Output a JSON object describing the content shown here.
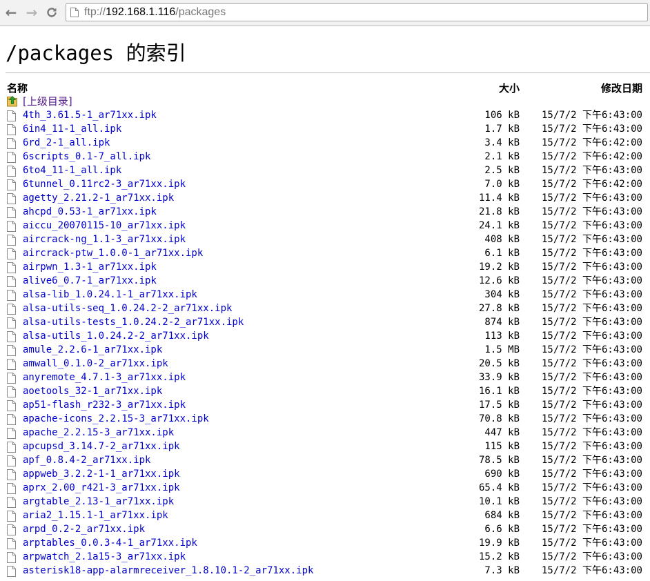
{
  "browser": {
    "url_scheme": "ftp://",
    "url_host": "192.168.1.116",
    "url_path": "/packages"
  },
  "page": {
    "title": "/packages 的索引",
    "columns": {
      "name": "名称",
      "size": "大小",
      "date": "修改日期"
    },
    "parent_link": "[上级目录]",
    "rows": [
      {
        "name": "4th_3.61.5-1_ar71xx.ipk",
        "size": "106 kB",
        "date": "15/7/2 下午6:43:00"
      },
      {
        "name": "6in4_11-1_all.ipk",
        "size": "1.7 kB",
        "date": "15/7/2 下午6:43:00"
      },
      {
        "name": "6rd_2-1_all.ipk",
        "size": "3.4 kB",
        "date": "15/7/2 下午6:42:00"
      },
      {
        "name": "6scripts_0.1-7_all.ipk",
        "size": "2.1 kB",
        "date": "15/7/2 下午6:42:00"
      },
      {
        "name": "6to4_11-1_all.ipk",
        "size": "2.5 kB",
        "date": "15/7/2 下午6:43:00"
      },
      {
        "name": "6tunnel_0.11rc2-3_ar71xx.ipk",
        "size": "7.0 kB",
        "date": "15/7/2 下午6:42:00"
      },
      {
        "name": "agetty_2.21.2-1_ar71xx.ipk",
        "size": "11.4 kB",
        "date": "15/7/2 下午6:43:00"
      },
      {
        "name": "ahcpd_0.53-1_ar71xx.ipk",
        "size": "21.8 kB",
        "date": "15/7/2 下午6:43:00"
      },
      {
        "name": "aiccu_20070115-10_ar71xx.ipk",
        "size": "24.1 kB",
        "date": "15/7/2 下午6:43:00"
      },
      {
        "name": "aircrack-ng_1.1-3_ar71xx.ipk",
        "size": "408 kB",
        "date": "15/7/2 下午6:43:00"
      },
      {
        "name": "aircrack-ptw_1.0.0-1_ar71xx.ipk",
        "size": "6.1 kB",
        "date": "15/7/2 下午6:43:00"
      },
      {
        "name": "airpwn_1.3-1_ar71xx.ipk",
        "size": "19.2 kB",
        "date": "15/7/2 下午6:43:00"
      },
      {
        "name": "alive6_0.7-1_ar71xx.ipk",
        "size": "12.6 kB",
        "date": "15/7/2 下午6:43:00"
      },
      {
        "name": "alsa-lib_1.0.24.1-1_ar71xx.ipk",
        "size": "304 kB",
        "date": "15/7/2 下午6:43:00"
      },
      {
        "name": "alsa-utils-seq_1.0.24.2-2_ar71xx.ipk",
        "size": "27.8 kB",
        "date": "15/7/2 下午6:43:00"
      },
      {
        "name": "alsa-utils-tests_1.0.24.2-2_ar71xx.ipk",
        "size": "874 kB",
        "date": "15/7/2 下午6:43:00"
      },
      {
        "name": "alsa-utils_1.0.24.2-2_ar71xx.ipk",
        "size": "113 kB",
        "date": "15/7/2 下午6:43:00"
      },
      {
        "name": "amule_2.2.6-1_ar71xx.ipk",
        "size": "1.5 MB",
        "date": "15/7/2 下午6:43:00"
      },
      {
        "name": "amwall_0.1.0-2_ar71xx.ipk",
        "size": "20.5 kB",
        "date": "15/7/2 下午6:43:00"
      },
      {
        "name": "anyremote_4.7.1-3_ar71xx.ipk",
        "size": "33.9 kB",
        "date": "15/7/2 下午6:43:00"
      },
      {
        "name": "aoetools_32-1_ar71xx.ipk",
        "size": "16.1 kB",
        "date": "15/7/2 下午6:43:00"
      },
      {
        "name": "ap51-flash_r232-3_ar71xx.ipk",
        "size": "17.5 kB",
        "date": "15/7/2 下午6:43:00"
      },
      {
        "name": "apache-icons_2.2.15-3_ar71xx.ipk",
        "size": "70.8 kB",
        "date": "15/7/2 下午6:43:00"
      },
      {
        "name": "apache_2.2.15-3_ar71xx.ipk",
        "size": "447 kB",
        "date": "15/7/2 下午6:43:00"
      },
      {
        "name": "apcupsd_3.14.7-2_ar71xx.ipk",
        "size": "115 kB",
        "date": "15/7/2 下午6:43:00"
      },
      {
        "name": "apf_0.8.4-2_ar71xx.ipk",
        "size": "78.5 kB",
        "date": "15/7/2 下午6:43:00"
      },
      {
        "name": "appweb_3.2.2-1-1_ar71xx.ipk",
        "size": "690 kB",
        "date": "15/7/2 下午6:43:00"
      },
      {
        "name": "aprx_2.00_r421-3_ar71xx.ipk",
        "size": "65.4 kB",
        "date": "15/7/2 下午6:43:00"
      },
      {
        "name": "argtable_2.13-1_ar71xx.ipk",
        "size": "10.1 kB",
        "date": "15/7/2 下午6:43:00"
      },
      {
        "name": "aria2_1.15.1-1_ar71xx.ipk",
        "size": "684 kB",
        "date": "15/7/2 下午6:43:00"
      },
      {
        "name": "arpd_0.2-2_ar71xx.ipk",
        "size": "6.6 kB",
        "date": "15/7/2 下午6:43:00"
      },
      {
        "name": "arptables_0.0.3-4-1_ar71xx.ipk",
        "size": "19.9 kB",
        "date": "15/7/2 下午6:43:00"
      },
      {
        "name": "arpwatch_2.1a15-3_ar71xx.ipk",
        "size": "15.2 kB",
        "date": "15/7/2 下午6:43:00"
      },
      {
        "name": "asterisk18-app-alarmreceiver_1.8.10.1-2_ar71xx.ipk",
        "size": "7.3 kB",
        "date": "15/7/2 下午6:43:00"
      }
    ]
  },
  "colors": {
    "link": "#0000cc",
    "visited": "#551a8b",
    "toolbar": "#f2f2f2"
  }
}
